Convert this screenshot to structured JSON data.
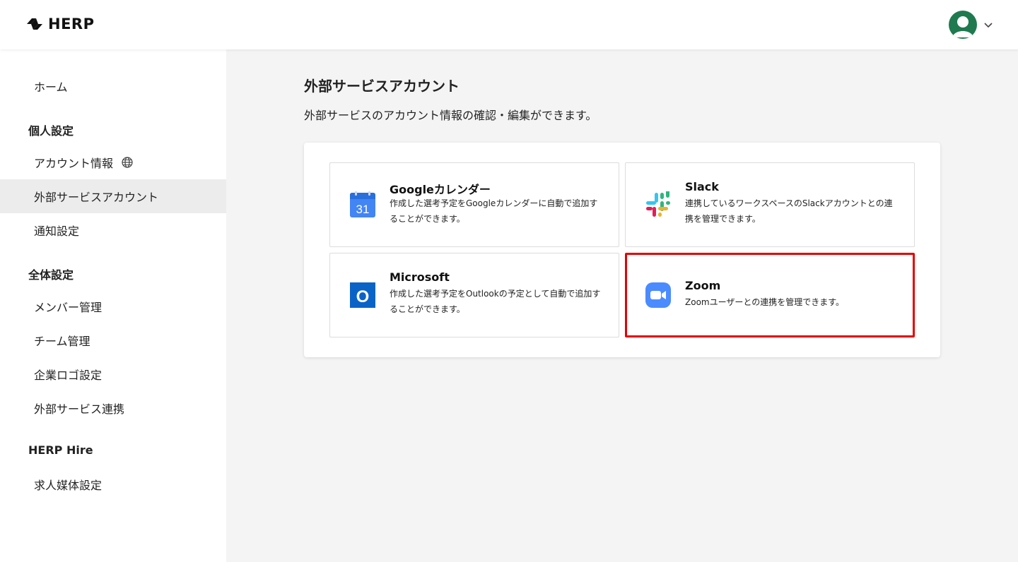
{
  "header": {
    "logo_text": "HERP"
  },
  "sidebar": {
    "home": "ホーム",
    "personal_section": "個人設定",
    "account_info": "アカウント情報",
    "external_accounts": "外部サービスアカウント",
    "notifications": "通知設定",
    "global_section": "全体設定",
    "members": "メンバー管理",
    "teams": "チーム管理",
    "company_logo": "企業ロゴ設定",
    "external_integrations": "外部サービス連携",
    "herp_hire_section": "HERP Hire",
    "job_media": "求人媒体設定"
  },
  "main": {
    "title": "外部サービスアカウント",
    "description": "外部サービスのアカウント情報の確認・編集ができます。"
  },
  "cards": [
    {
      "title": "Googleカレンダー",
      "desc_line1": "作成した選考予定をGoogleカレンダーに自動で追加す",
      "desc_line2": "ることができます。",
      "icon": "google-calendar-icon",
      "icon_text": "31"
    },
    {
      "title": "Slack",
      "desc_line1": "連携しているワークスペースのSlackアカウントとの連",
      "desc_line2": "携を管理できます。",
      "icon": "slack-icon"
    },
    {
      "title": "Microsoft",
      "desc_line1": "作成した選考予定をOutlookの予定として自動で追加す",
      "desc_line2": "ることができます。",
      "icon": "outlook-icon",
      "icon_text": "O"
    },
    {
      "title": "Zoom",
      "desc_line1": "Zoomユーザーとの連携を管理できます。",
      "icon": "zoom-icon"
    }
  ],
  "colors": {
    "highlight": "#e60000",
    "avatar": "#1f7a4f",
    "sidebar_active": "#ececec",
    "background": "#f4f4f4"
  }
}
